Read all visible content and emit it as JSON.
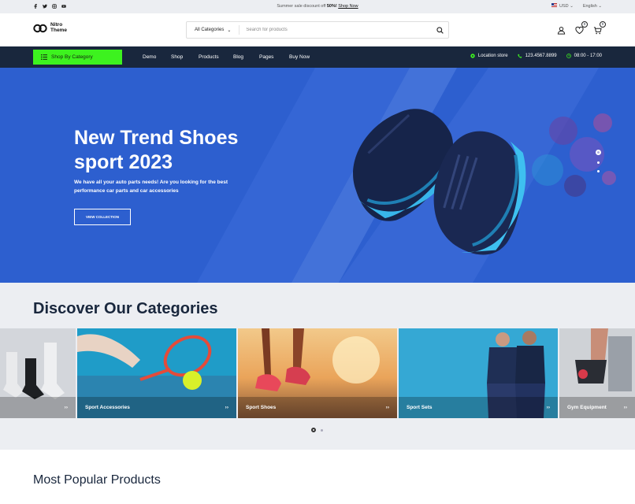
{
  "topbar": {
    "promo_text": "Summer sale discount off",
    "promo_percent": "50%!",
    "promo_link": "Shop Now",
    "currency": "USD",
    "language": "English",
    "social_icons": [
      "facebook-icon",
      "twitter-icon",
      "instagram-icon",
      "youtube-icon"
    ]
  },
  "header": {
    "logo_line1": "Nitro",
    "logo_line2": "Theme",
    "category_select": "All Categories",
    "search_placeholder": "Search for products",
    "wishlist_count": "0",
    "cart_count": "0"
  },
  "nav": {
    "shop_by_category": "Shop By Category",
    "menu": [
      "Demo",
      "Shop",
      "Products",
      "Blog",
      "Pages",
      "Buy Now"
    ],
    "location": "Location store",
    "phone": "123.4567.8899",
    "hours": "08:00 - 17:00"
  },
  "hero": {
    "title_line1": "New Trend Shoes",
    "title_line2": "sport 2023",
    "description": "We have all your auto parts needs! Are you looking for the best performance car parts and car accessories",
    "button": "VIEW COLLECTION",
    "bg_color": "#2d5fcf"
  },
  "categories": {
    "heading": "Discover Our Categories",
    "items": [
      {
        "label": ""
      },
      {
        "label": "Sport Accessories"
      },
      {
        "label": "Sport Shoes"
      },
      {
        "label": "Sport Sets"
      },
      {
        "label": "Gym Equipment"
      }
    ],
    "arrow": "››"
  },
  "popular": {
    "heading": "Most Popular Products"
  },
  "colors": {
    "accent": "#3df21f",
    "nav_bg": "#19273d",
    "hero_bg": "#2d5fcf"
  }
}
